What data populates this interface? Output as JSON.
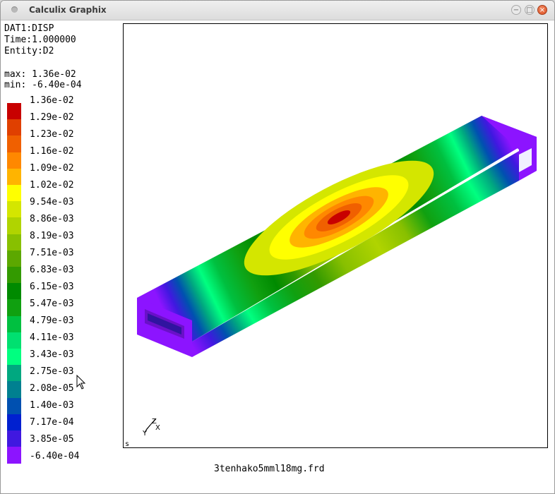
{
  "window": {
    "title": "Calculix Graphix"
  },
  "info": {
    "dataset": "DAT1:DISP",
    "time": "Time:1.000000",
    "entity": "Entity:D2",
    "max": "max: 1.36e-02",
    "min": "min: -6.40e-04"
  },
  "legend": [
    {
      "label": "1.36e-02",
      "color": "#c80000"
    },
    {
      "label": "1.29e-02",
      "color": "#e04000"
    },
    {
      "label": "1.23e-02",
      "color": "#f06000"
    },
    {
      "label": "1.16e-02",
      "color": "#ff8800"
    },
    {
      "label": "1.09e-02",
      "color": "#ffb400"
    },
    {
      "label": "1.02e-02",
      "color": "#ffff00"
    },
    {
      "label": "9.54e-03",
      "color": "#d4e600"
    },
    {
      "label": "8.86e-03",
      "color": "#b0d400"
    },
    {
      "label": "8.19e-03",
      "color": "#88c000"
    },
    {
      "label": "7.51e-03",
      "color": "#5ca800"
    },
    {
      "label": "6.83e-03",
      "color": "#339a00"
    },
    {
      "label": "6.15e-03",
      "color": "#008a00"
    },
    {
      "label": "5.47e-03",
      "color": "#10a010"
    },
    {
      "label": "4.79e-03",
      "color": "#00c040"
    },
    {
      "label": "4.11e-03",
      "color": "#00e070"
    },
    {
      "label": "3.43e-03",
      "color": "#00ff80"
    },
    {
      "label": "2.75e-03",
      "color": "#00a880"
    },
    {
      "label": "2.08e-05",
      "color": "#008090"
    },
    {
      "label": "1.40e-03",
      "color": "#0050b0"
    },
    {
      "label": "7.17e-04",
      "color": "#0020d0"
    },
    {
      "label": "3.85e-05",
      "color": "#4018e0"
    },
    {
      "label": "-6.40e-04",
      "color": "#8c14ff"
    }
  ],
  "axis": {
    "z": "Z",
    "x": "X",
    "y": "Y"
  },
  "s_label": "s",
  "filename": "3tenhako5mml18mg.frd"
}
